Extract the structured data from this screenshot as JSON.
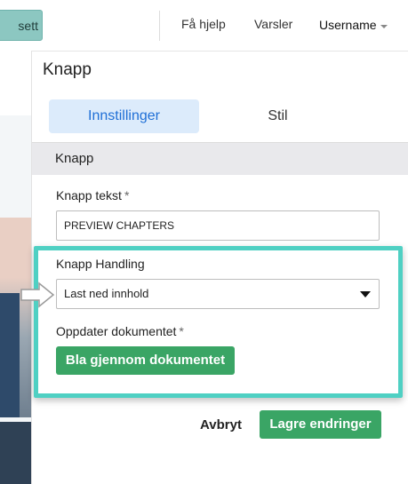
{
  "topbar": {
    "continue_label": "sett",
    "help_label": "Få hjelp",
    "alerts_label": "Varsler",
    "username_label": "Username"
  },
  "panel": {
    "title": "Knapp",
    "tabs": [
      {
        "label": "Innstillinger",
        "active": true
      },
      {
        "label": "Stil",
        "active": false
      }
    ],
    "section_title": "Knapp"
  },
  "form": {
    "button_text": {
      "label": "Knapp tekst",
      "required_mark": "*",
      "value": "PREVIEW CHAPTERS"
    },
    "button_action": {
      "label": "Knapp Handling",
      "selected": "Last ned innhold"
    },
    "update_document": {
      "label": "Oppdater dokumentet",
      "required_mark": "*",
      "browse_label": "Bla gjennom dokumentet"
    }
  },
  "footer": {
    "cancel_label": "Avbryt",
    "save_label": "Lagre endringer"
  },
  "colors": {
    "accent_blue": "#1f6fd6",
    "primary_green": "#3aa565",
    "highlight_teal": "#4fd0c3",
    "tab_active_bg": "#dcebfb"
  },
  "icons": {
    "user_menu": "chevron-down-icon",
    "select_toggle": "caret-down-icon",
    "annotation": "pointer-arrow-icon"
  }
}
